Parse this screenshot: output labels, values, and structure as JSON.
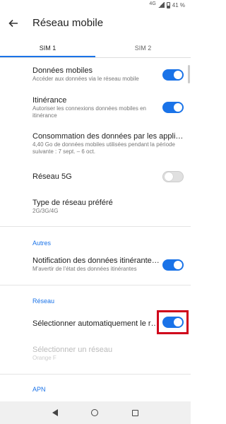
{
  "status": {
    "network": "4G",
    "battery": "41 %"
  },
  "header": {
    "title": "Réseau mobile"
  },
  "tabs": [
    {
      "label": "SIM 1"
    },
    {
      "label": "SIM 2"
    }
  ],
  "items": {
    "mobile_data": {
      "title": "Données mobiles",
      "subtitle": "Accéder aux données via le réseau mobile",
      "state": "on"
    },
    "roaming": {
      "title": "Itinérance",
      "subtitle": "Autoriser les connexions données mobiles en itinérance",
      "state": "on"
    },
    "data_usage": {
      "title": "Consommation des données par les applicat…",
      "subtitle": "4,40 Go de données mobiles utilisées pendant la période suivante : 7 sept. – 6 oct."
    },
    "network_5g": {
      "title": "Réseau 5G",
      "state": "off"
    },
    "network_type": {
      "title": "Type de réseau préféré",
      "subtitle": "2G/3G/4G"
    },
    "roaming_notification": {
      "title": "Notification des données itinérantes…",
      "subtitle": "M'avertir de l'état des données itinérantes",
      "state": "on"
    },
    "auto_select": {
      "title": "Sélectionner automatiquement le ré…",
      "state": "on"
    },
    "select_network": {
      "title": "Sélectionner un réseau",
      "subtitle": "Orange F"
    }
  },
  "sections": {
    "others": "Autres",
    "network": "Réseau",
    "apn": "APN"
  },
  "colors": {
    "accent": "#1a73e8",
    "highlight": "#d0021b"
  }
}
